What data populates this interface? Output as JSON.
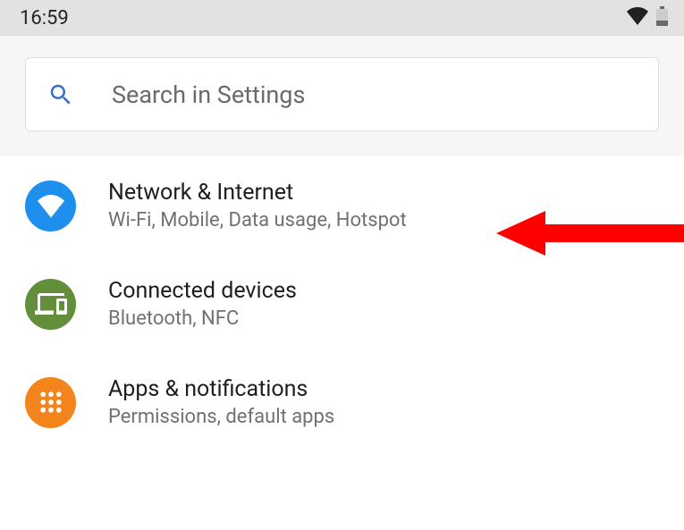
{
  "status_bar": {
    "time": "16:59"
  },
  "search": {
    "placeholder": "Search in Settings"
  },
  "settings": [
    {
      "id": "network-internet",
      "title": "Network & Internet",
      "subtitle": "Wi-Fi, Mobile, Data usage, Hotspot",
      "icon": "wifi-icon",
      "color": "#1f8fee"
    },
    {
      "id": "connected-devices",
      "title": "Connected devices",
      "subtitle": "Bluetooth, NFC",
      "icon": "devices-icon",
      "color": "#638f3c"
    },
    {
      "id": "apps-notifications",
      "title": "Apps & notifications",
      "subtitle": "Permissions, default apps",
      "icon": "apps-icon",
      "color": "#f3851c"
    }
  ],
  "annotation": {
    "arrow_target": "network-internet",
    "arrow_color": "#ff0000"
  }
}
